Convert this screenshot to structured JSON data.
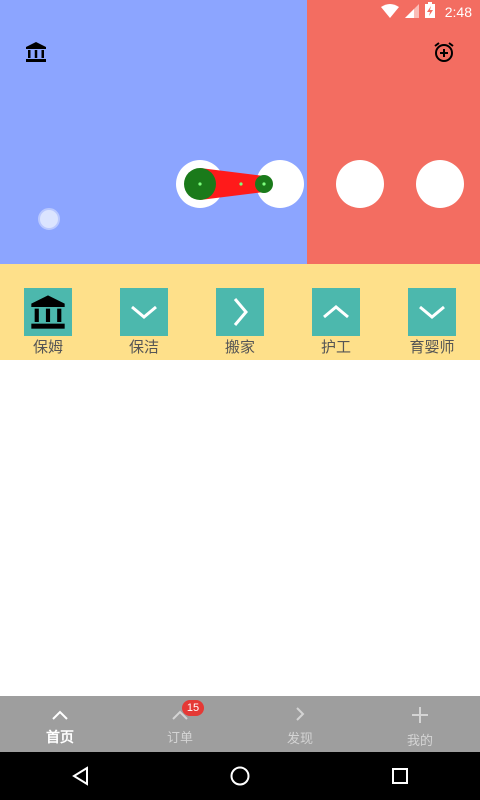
{
  "status_bar": {
    "time": "2:48",
    "icons": [
      "wifi-icon",
      "signal-icon",
      "battery-charging-icon"
    ]
  },
  "banner": {
    "left_icon": "bank-icon",
    "right_icon": "alarm-add-icon",
    "colors": {
      "left_panel": "#8ca5ff",
      "right_panel": "#f36d61"
    }
  },
  "categories": [
    {
      "label": "保姆",
      "icon": "bank-icon"
    },
    {
      "label": "保洁",
      "icon": "chevron-down-icon"
    },
    {
      "label": "搬家",
      "icon": "chevron-right-icon"
    },
    {
      "label": "护工",
      "icon": "chevron-up-icon"
    },
    {
      "label": "育婴师",
      "icon": "chevron-down-icon"
    }
  ],
  "tabs": [
    {
      "label": "首页",
      "icon": "chevron-up-icon",
      "active": true
    },
    {
      "label": "订单",
      "icon": "chevron-up-icon",
      "badge": "15"
    },
    {
      "label": "发现",
      "icon": "chevron-right-icon"
    },
    {
      "label": "我的",
      "icon": "plus-icon"
    }
  ],
  "nav": [
    "back-icon",
    "home-icon",
    "recents-icon"
  ]
}
